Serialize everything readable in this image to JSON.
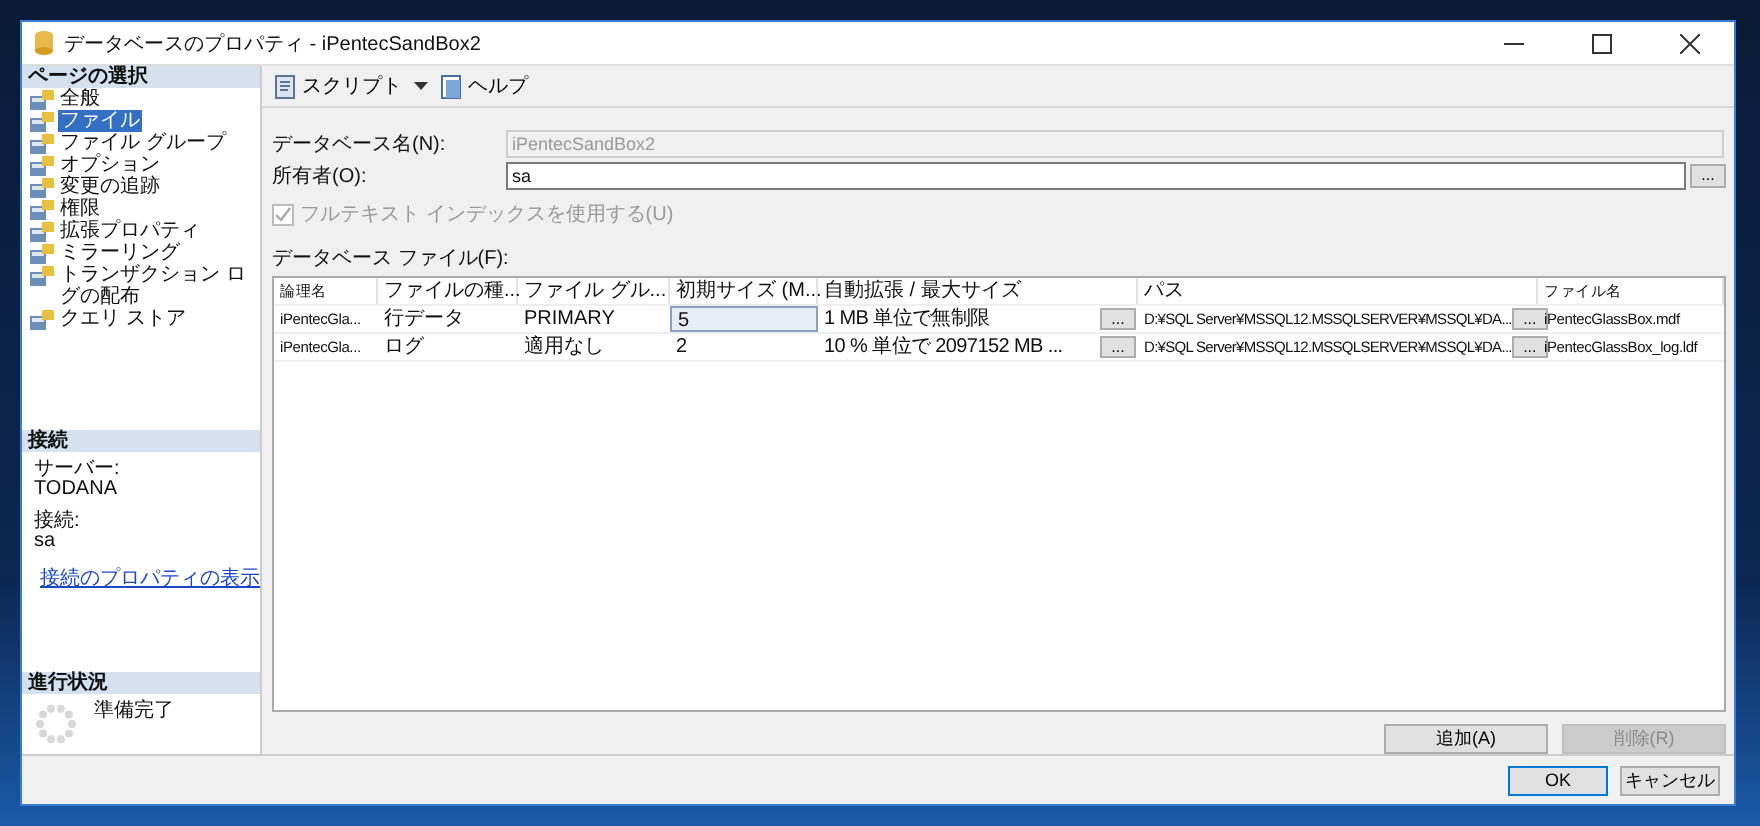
{
  "window": {
    "title": "データベースのプロパティ - iPentecSandBox2"
  },
  "sidebar": {
    "header": "ページの選択",
    "items": [
      {
        "label": "全般",
        "selected": false
      },
      {
        "label": "ファイル",
        "selected": true
      },
      {
        "label": "ファイル グループ",
        "selected": false
      },
      {
        "label": "オプション",
        "selected": false
      },
      {
        "label": "変更の追跡",
        "selected": false
      },
      {
        "label": "権限",
        "selected": false
      },
      {
        "label": "拡張プロパティ",
        "selected": false
      },
      {
        "label": "ミラーリング",
        "selected": false
      },
      {
        "label": "トランザクション ログの配布",
        "selected": false
      },
      {
        "label": "クエリ ストア",
        "selected": false
      }
    ]
  },
  "connection": {
    "header": "接続",
    "server_label": "サーバー:",
    "server": "TODANA",
    "login_label": "接続:",
    "login": "sa",
    "link": "接続のプロパティの表示"
  },
  "progress": {
    "header": "進行状況",
    "status": "準備完了"
  },
  "toolbar": {
    "script": "スクリプト",
    "help": "ヘルプ"
  },
  "form": {
    "db_name_label": "データベース名(N):",
    "db_name": "iPentecSandBox2",
    "owner_label": "所有者(O):",
    "owner": "sa",
    "owner_button": "...",
    "fulltext": {
      "label": "フルテキスト インデックスを使用する(U)",
      "checked": true,
      "disabled": true
    }
  },
  "files": {
    "label": "データベース ファイル(F):",
    "columns": [
      "論理名",
      "ファイルの種...",
      "ファイル グル...",
      "初期サイズ (M...",
      "自動拡張 / 最大サイズ",
      "パス",
      "ファイル名"
    ],
    "rows": [
      {
        "name": "iPentecGla...",
        "type": "行データ",
        "filegroup": "PRIMARY",
        "size": "5",
        "focused": true,
        "autogrowth": "1 MB 単位で無制限",
        "autogrowth_button": "...",
        "path": "D:¥SQL Server¥MSSQL12.MSSQLSERVER¥MSSQL¥DA...",
        "path_button": "...",
        "filename": "iPentecGlassBox.mdf"
      },
      {
        "name": "iPentecGla...",
        "type": "ログ",
        "filegroup": "適用なし",
        "size": "2",
        "focused": false,
        "autogrowth": "10 % 単位で 2097152 MB ...",
        "autogrowth_button": "...",
        "path": "D:¥SQL Server¥MSSQL12.MSSQLSERVER¥MSSQL¥DA...",
        "path_button": "...",
        "filename": "iPentecGlassBox_log.ldf"
      }
    ],
    "add": {
      "label": "追加(A)",
      "disabled": false
    },
    "remove": {
      "label": "削除(R)",
      "disabled": true
    }
  },
  "buttons": [
    {
      "label": "OK",
      "default": true
    },
    {
      "label": "キャンセル",
      "default": false
    }
  ]
}
